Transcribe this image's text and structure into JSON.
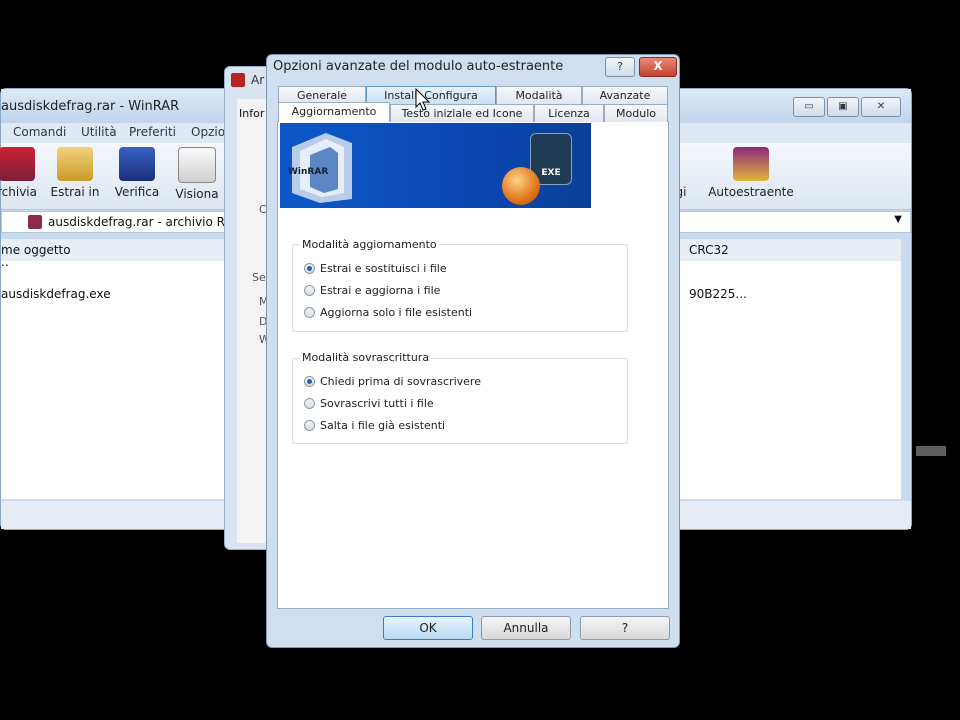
{
  "winrar": {
    "title": "ausdiskdefrag.rar - WinRAR",
    "menu": [
      "Comandi",
      "Utilità",
      "Preferiti",
      "Opzio"
    ],
    "toolbar": [
      "rchivia",
      "Estrai in",
      "Verifica",
      "Visiona",
      "gi",
      "Autoestraente"
    ],
    "path": "ausdiskdefrag.rar - archivio R",
    "columns": {
      "name": "me oggetto",
      "crc": "CRC32"
    },
    "rows": [
      {
        "name": "..",
        "crc": ""
      },
      {
        "name": "ausdiskdefrag.exe",
        "crc": "90B225..."
      }
    ]
  },
  "middle_dialog": {
    "title": "Ar",
    "tab_partial": "Infor",
    "fragments": [
      "C",
      "Se",
      "M",
      "D",
      "W"
    ]
  },
  "dialog": {
    "title": "Opzioni avanzate del modulo auto-estraente",
    "help": "?",
    "close": "X",
    "tabs_row1": [
      "Generale",
      "Install. Configura",
      "Modalità",
      "Avanzate"
    ],
    "tabs_row2": [
      "Aggiornamento",
      "Testo iniziale ed Icone",
      "Licenza",
      "Modulo"
    ],
    "active_tab": "Aggiornamento",
    "banner": {
      "exe_label": "EXE",
      "winrar_label": "WinRAR"
    },
    "update_mode": {
      "title": "Modalità aggiornamento",
      "options": [
        "Estrai e sostituisci i file",
        "Estrai e aggiorna i file",
        "Aggiorna solo i file esistenti"
      ],
      "selected": 0
    },
    "overwrite_mode": {
      "title": "Modalità sovrascrittura",
      "options": [
        "Chiedi prima di sovrascrivere",
        "Sovrascrivi tutti i file",
        "Salta i file già esistenti"
      ],
      "selected": 0
    },
    "buttons": {
      "ok": "OK",
      "cancel": "Annulla",
      "help": "?"
    }
  },
  "colors": {
    "accent": "#2a5fb0",
    "banner": "#0d58c9",
    "close": "#c4412e"
  }
}
